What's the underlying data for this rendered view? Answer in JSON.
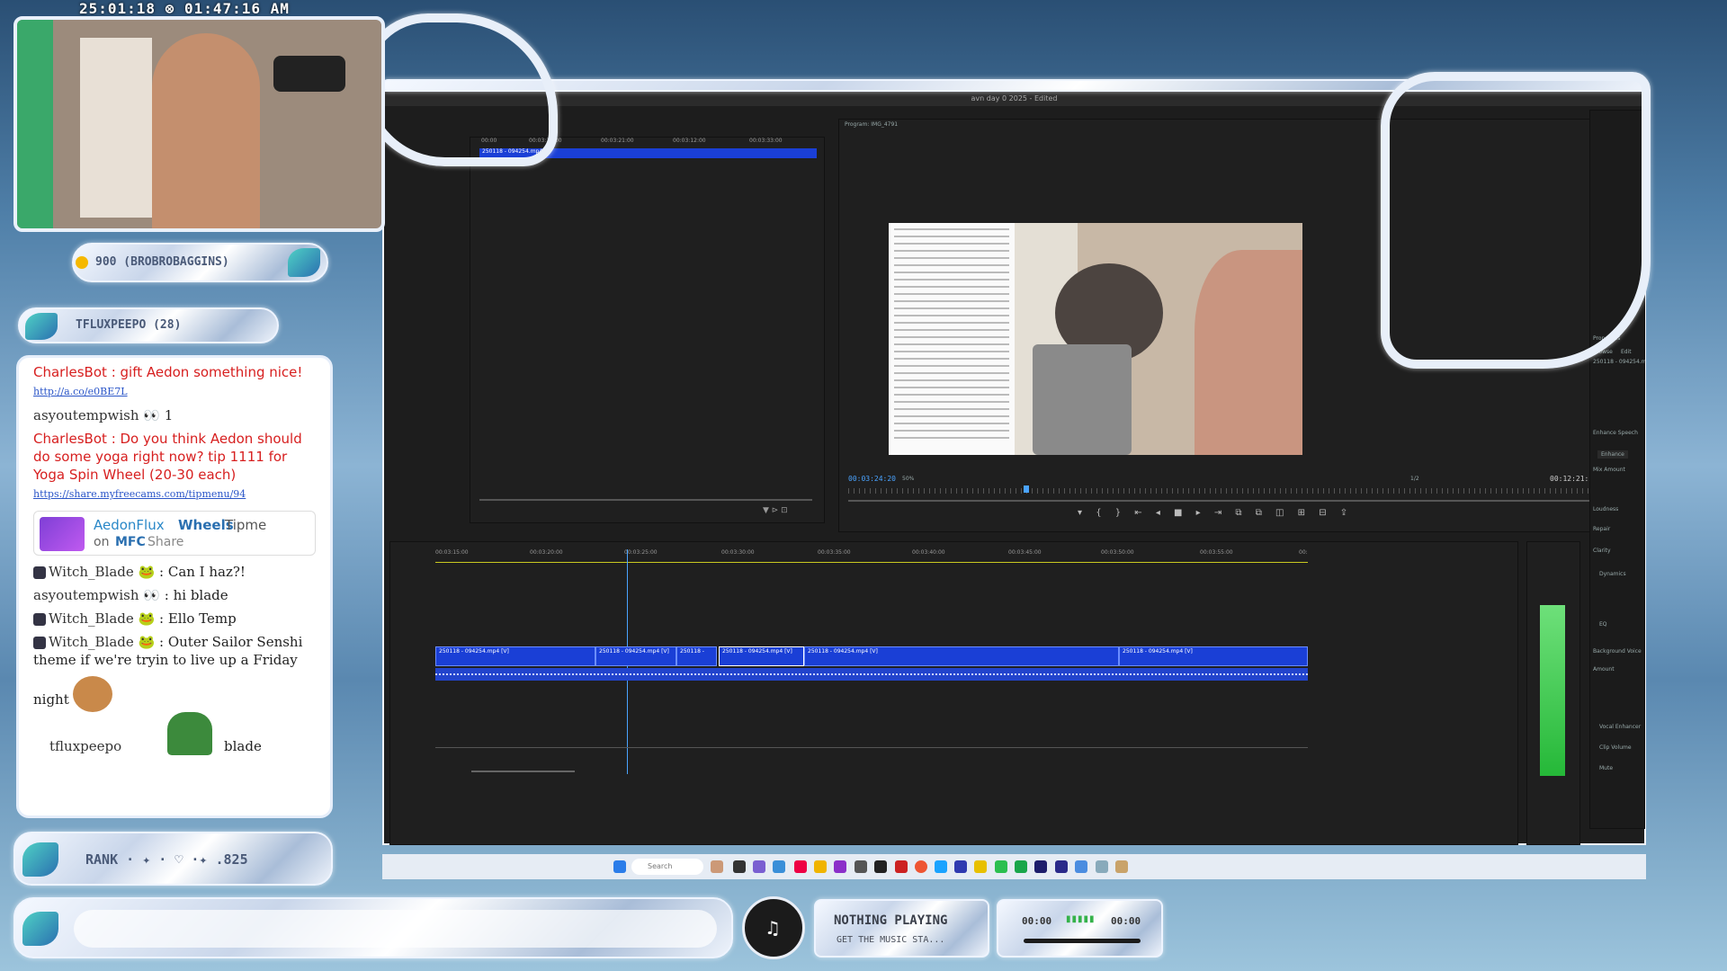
{
  "overlay": {
    "clock": "25:01:18 ⊗ 01:47:16 AM",
    "sub_alert": "900 (BROBROBAGGINS)",
    "latest_follow": "TFLUXPEEPO (28)",
    "rank": "RANK · ✦ · ♡ ·✦ .825",
    "music": {
      "title": "NOTHING PLAYING",
      "subtitle": "GET THE MUSIC STA...",
      "time_start": "00:00",
      "time_end": "00:00",
      "bars": "▮▮▮▮▮"
    }
  },
  "editor": {
    "title": "avn day 0 2025 - Edited",
    "program_label": "Program: IMG_4791",
    "source_clip": "250118 - 094254.mp4",
    "source_ticks": [
      "00:00",
      "00:03:30:00",
      "00:03:21:00",
      "00:03:12:00",
      "00:03:33:00"
    ],
    "program_timecode": "00:03:24:20",
    "zoom": "50%",
    "fraction": "1/2",
    "duration": "00:12:21:20",
    "tl_ticks": [
      "00:03:15:00",
      "00:03:20:00",
      "00:03:25:00",
      "00:03:30:00",
      "00:03:35:00",
      "00:03:40:00",
      "00:03:45:00",
      "00:03:50:00",
      "00:03:55:00",
      "00:"
    ],
    "clips": [
      "250118 - 094254.mp4 [V]",
      "250118 - 094254.mp4 [V]",
      "250118 -",
      "250118 - 094254.mp4 [V]",
      "250118 - 094254.mp4 [V]",
      "250118 - 094254.mp4 [V]"
    ],
    "props": {
      "header": "Properties",
      "tab1": "Browse",
      "tab2": "Edit",
      "file": "250118 - 094254.mp4",
      "enhance": "Enhance Speech",
      "enhance_btn": "Enhance",
      "mix": "Mix Amount",
      "loudness": "Loudness",
      "repair": "Repair",
      "clarity": "Clarity",
      "dynamics": "Dynamics",
      "eq": "EQ",
      "bg": "Background Voice",
      "amount": "Amount",
      "vocal": "Vocal Enhancer",
      "clipvol": "Clip Volume",
      "mute": "Mute"
    }
  },
  "chat": {
    "m1": {
      "user": "CharlesBot",
      "text": ": gift Aedon something nice!",
      "link": "http://a.co/e0BE7L"
    },
    "m2": {
      "user": "asyoutempwish",
      "text": "1"
    },
    "m3": {
      "user": "CharlesBot",
      "text": ": Do you think Aedon should do some yoga right now? tip 1111 for Yoga Spin Wheel (20-30 each)",
      "link": "https://share.myfreecams.com/tipmenu/94"
    },
    "tip": {
      "name": "AedonFlux",
      "wheel": "Wheels",
      "rest": " Tipme",
      "platform_pre": "on ",
      "platform": "MFC",
      "platform_post": "Share"
    },
    "m4": {
      "user": "Witch_Blade",
      "text": ": Can I haz?!"
    },
    "m5": {
      "user": "asyoutempwish",
      "text": ": hi blade"
    },
    "m6": {
      "user": "Witch_Blade",
      "text": ": Ello Temp"
    },
    "m7": {
      "user": "Witch_Blade",
      "text": ": Outer Sailor Senshi theme if we're tryin to live up a Friday"
    },
    "m7b": "night",
    "m8": {
      "user": "tfluxpeepo",
      "text": "blade"
    }
  },
  "taskbar": {
    "search": "Search"
  },
  "colors": {
    "accent": "#1a3fd6",
    "chat_red": "#d71f1f",
    "meter": "#39d24a"
  }
}
